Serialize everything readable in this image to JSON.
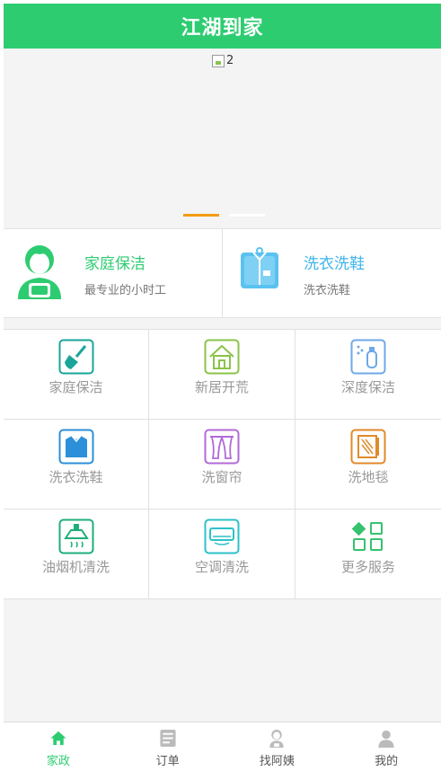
{
  "header": {
    "title": "江湖到家"
  },
  "banner": {
    "image_alt": "2",
    "active_index": 0,
    "slide_count": 2
  },
  "promos": [
    {
      "title": "家庭保洁",
      "subtitle": "最专业的小时工",
      "icon": "housekeeper-icon",
      "color": "#2ecc71"
    },
    {
      "title": "洗衣洗鞋",
      "subtitle": "洗衣洗鞋",
      "icon": "shirt-icon",
      "color": "#40b5ea"
    }
  ],
  "services": [
    {
      "label": "家庭保洁",
      "icon": "broom-icon",
      "color": "#1aa59a"
    },
    {
      "label": "新居开荒",
      "icon": "house-icon",
      "color": "#8bc34a"
    },
    {
      "label": "深度保洁",
      "icon": "spray-bottle-icon",
      "color": "#6ea8e8"
    },
    {
      "label": "洗衣洗鞋",
      "icon": "shirt-icon",
      "color": "#2c8fd9"
    },
    {
      "label": "洗窗帘",
      "icon": "curtain-icon",
      "color": "#b06ad8"
    },
    {
      "label": "洗地毯",
      "icon": "carpet-icon",
      "color": "#e08a2a"
    },
    {
      "label": "油烟机清洗",
      "icon": "range-hood-icon",
      "color": "#1fae7a"
    },
    {
      "label": "空调清洗",
      "icon": "air-conditioner-icon",
      "color": "#2cc1c8"
    },
    {
      "label": "更多服务",
      "icon": "more-services-icon",
      "color": "#35c26e"
    }
  ],
  "tabs": [
    {
      "label": "家政",
      "icon": "home-icon",
      "active": true
    },
    {
      "label": "订单",
      "icon": "order-icon",
      "active": false
    },
    {
      "label": "找阿姨",
      "icon": "find-aunt-icon",
      "active": false
    },
    {
      "label": "我的",
      "icon": "profile-icon",
      "active": false
    }
  ],
  "colors": {
    "brand": "#2ecc71",
    "indicator_active": "#f39c12",
    "tab_inactive_icon": "#bbbbbb"
  }
}
